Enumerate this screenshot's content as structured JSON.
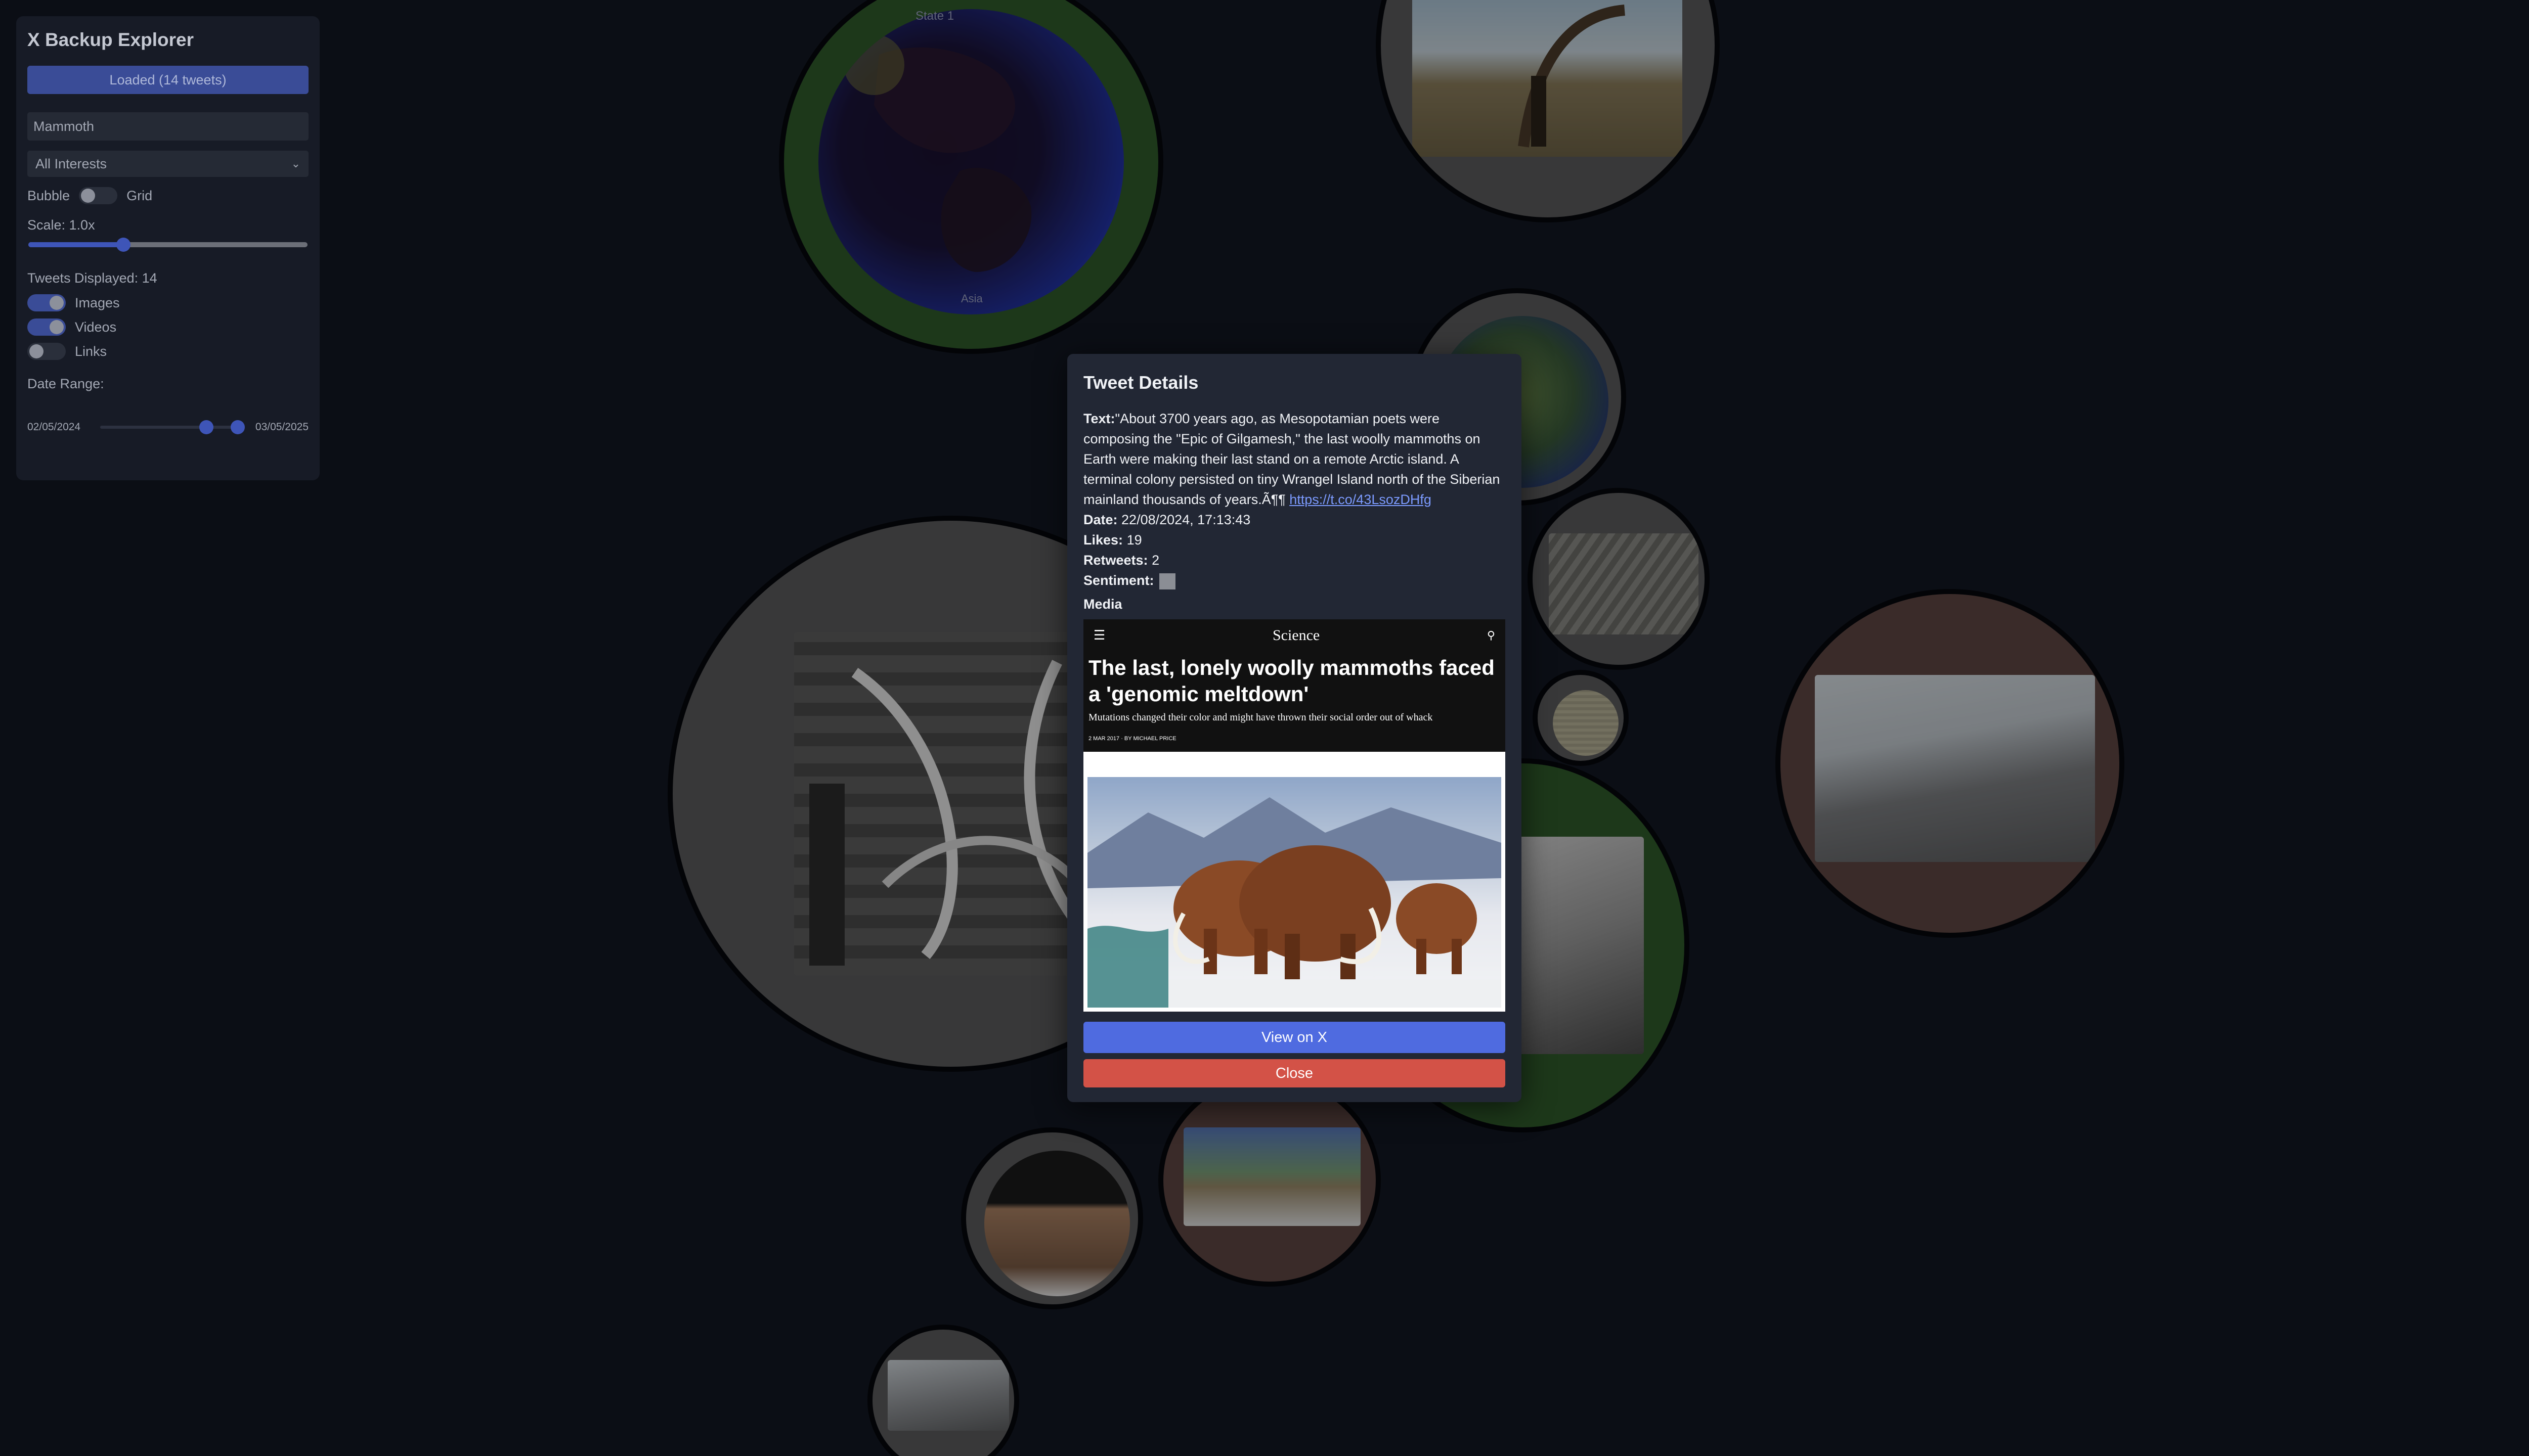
{
  "app": {
    "title": "X Backup Explorer"
  },
  "panel": {
    "loaded_label": "Loaded (14 tweets)",
    "search_value": "Mammoth",
    "interest_select": "All Interests",
    "view_left": "Bubble",
    "view_right": "Grid",
    "view_mode": "Bubble",
    "scale_label": "Scale: 1.0x",
    "scale_fraction": 0.34,
    "tweets_displayed": "Tweets Displayed: 14",
    "filters": [
      {
        "label": "Images",
        "on": true
      },
      {
        "label": "Videos",
        "on": true
      },
      {
        "label": "Links",
        "on": false
      }
    ],
    "date_range_label": "Date Range:",
    "date_start": "02/05/2024",
    "date_end": "03/05/2025"
  },
  "modal": {
    "title": "Tweet Details",
    "text_label": "Text:",
    "text": "\"About 3700 years ago, as Mesopotamian poets were composing the \"Epic of Gilgamesh,\" the last woolly mammoths on Earth were making their last stand on a remote Arctic island. A terminal colony persisted on tiny Wrangel Island north of the Siberian mainland thousands of years.Ã¶¶",
    "link": "https://t.co/43LsozDHfg",
    "date_label": "Date:",
    "date": "22/08/2024, 17:13:43",
    "likes_label": "Likes:",
    "likes": "19",
    "retweets_label": "Retweets:",
    "retweets": "2",
    "sentiment_label": "Sentiment:",
    "media_label": "Media",
    "view_button": "View on X",
    "close_button": "Close",
    "media": {
      "site": "Science",
      "headline": "The last, lonely woolly mammoths faced a 'genomic meltdown'",
      "subhead": "Mutations changed their color and might have thrown their social order out of whack",
      "meta": "2 MAR 2017 · BY MICHAEL PRICE"
    }
  },
  "bubbles": [
    {
      "id": "globe",
      "label": "State 1",
      "footer": "Asia"
    }
  ],
  "colors": {
    "background": "#0b0e15",
    "panel": "#171b26",
    "accent": "#3a4c97",
    "view_button": "#4f6be0",
    "close_button": "#d35247",
    "ring_green": "#2f5a2a",
    "ring_grey": "#5a5a5c",
    "ring_red": "#5e4542"
  }
}
